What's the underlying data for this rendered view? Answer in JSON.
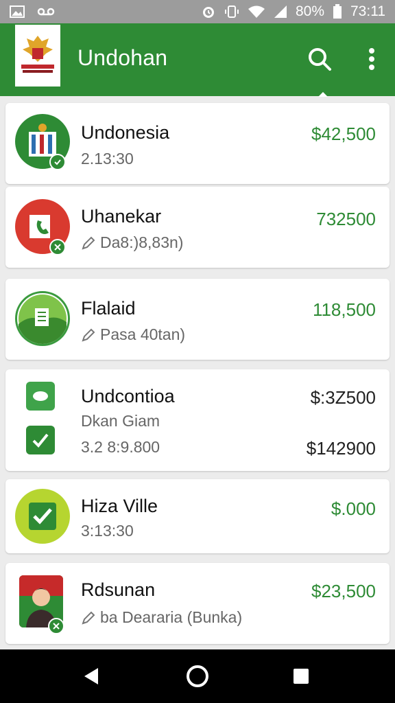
{
  "status_bar": {
    "battery_percent": "80%",
    "time": "73:11",
    "icons": [
      "image-icon",
      "voicemail-icon",
      "alarm-icon",
      "vibrate-icon",
      "wifi-icon",
      "signal-icon",
      "battery-icon"
    ]
  },
  "app_bar": {
    "title": "Undohan",
    "actions": [
      "search-icon",
      "more-vert-icon"
    ]
  },
  "items": [
    {
      "name": "Undonesia",
      "subtitle": "2.13:30",
      "amount": "$42,500",
      "amount_color": "#2e8b35"
    },
    {
      "name": "Uhanekar",
      "subtitle": "Da8:)8,83n)",
      "amount": "732500",
      "amount_color": "#2e8b35"
    },
    {
      "name": "Flalaid",
      "subtitle": "Pasa 40tan)",
      "amount": "118,500",
      "amount_color": "#2e8b35"
    },
    {
      "name": "Undcontioa",
      "subtitle": "Dkan Giam",
      "subtitle2": "3.2 8:9.800",
      "amount": "$:3Z500",
      "amount2": "$142900",
      "amount_color": "#222222"
    },
    {
      "name": "Hiza Ville",
      "subtitle": "3:13:30",
      "amount": "$.000",
      "amount_color": "#2e8b35"
    },
    {
      "name": "Rdsunan",
      "subtitle": "ba Deararia (Bunka)",
      "amount": "$23,500",
      "amount_color": "#2e8b35"
    }
  ],
  "colors": {
    "primary": "#2e8b35",
    "status_bar": "#9c9c9c",
    "background": "#ececec"
  },
  "nav_bar": {
    "buttons": [
      "back-icon",
      "home-icon",
      "recents-icon"
    ]
  }
}
